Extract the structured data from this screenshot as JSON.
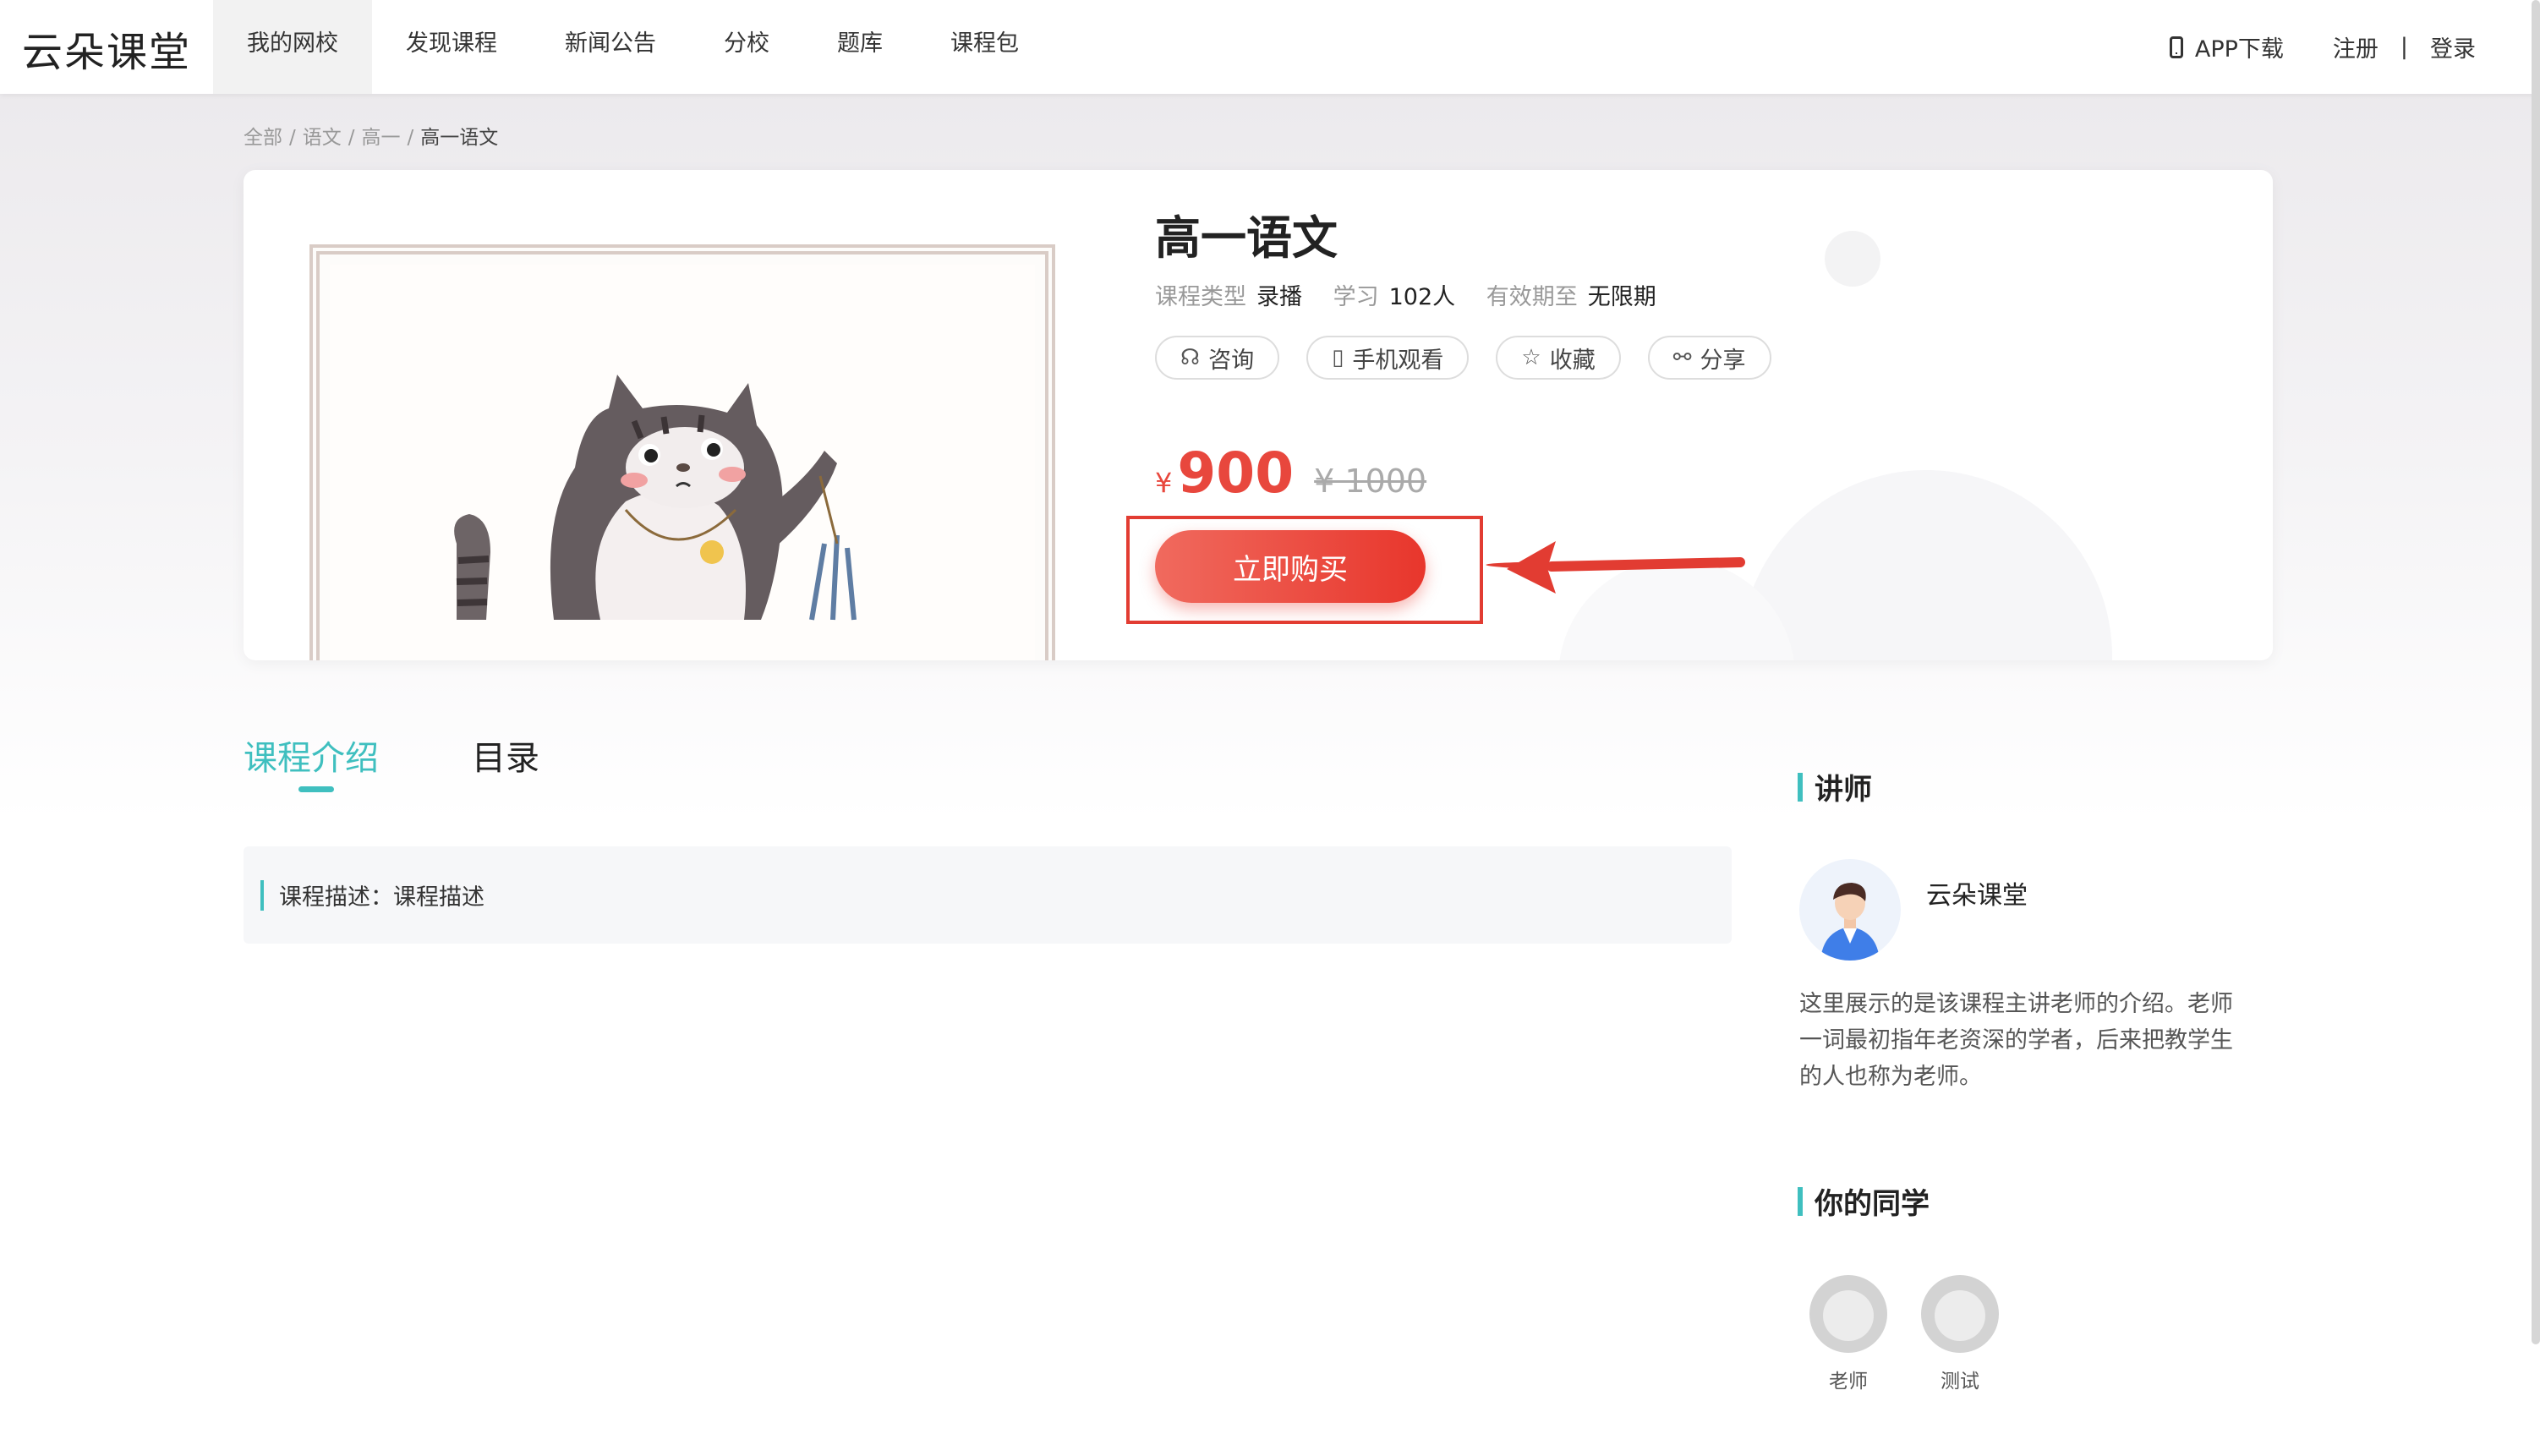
{
  "header": {
    "logo": "云朵课堂",
    "nav": [
      "我的网校",
      "发现课程",
      "新闻公告",
      "分校",
      "题库",
      "课程包"
    ],
    "app_download": "APP下载",
    "register": "注册",
    "separator": "|",
    "login": "登录"
  },
  "breadcrumb": [
    "全部",
    "语文",
    "高一",
    "高一语文"
  ],
  "course": {
    "title": "高一语文",
    "type_label": "课程类型",
    "type_value": "录播",
    "learn_label": "学习",
    "learn_value": "102人",
    "valid_label": "有效期至",
    "valid_value": "无限期",
    "actions": [
      {
        "label": "咨询",
        "icon": "headset-icon"
      },
      {
        "label": "手机观看",
        "icon": "phone-icon"
      },
      {
        "label": "收藏",
        "icon": "star-icon"
      },
      {
        "label": "分享",
        "icon": "share-icon"
      }
    ],
    "currency": "¥",
    "price": "900",
    "original_price": "¥ 1000",
    "buy_label": "立即购买"
  },
  "tabs": [
    "课程介绍",
    "目录"
  ],
  "description": "课程描述：课程描述",
  "sidebar": {
    "teacher_heading": "讲师",
    "teacher_name": "云朵课堂",
    "teacher_intro": "这里展示的是该课程主讲老师的介绍。老师一词最初指年老资深的学者，后来把教学生的人也称为老师。",
    "classmates_heading": "你的同学",
    "classmates": [
      "老师",
      "测试"
    ]
  },
  "colors": {
    "accent": "#3fbfbf",
    "price": "#e8473d",
    "annotation": "#e23c32"
  }
}
